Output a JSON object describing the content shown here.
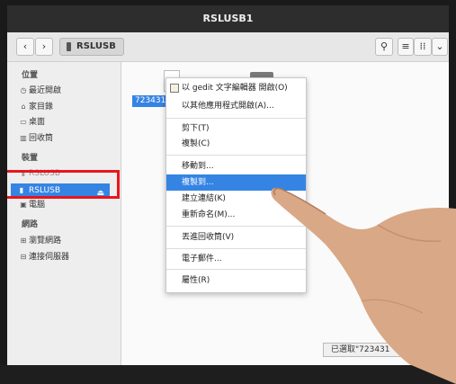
{
  "window": {
    "title": "RSLUSB1"
  },
  "toolbar": {
    "back_icon": "chevron-left-icon",
    "forward_icon": "chevron-right-icon",
    "path_label": "RSLUSB",
    "search_icon": "search-icon",
    "list_icon": "list-view-icon",
    "grid_icon": "grid-view-icon",
    "menu_icon": "chevron-down-icon"
  },
  "sidebar": {
    "places_heading": "位置",
    "places": [
      {
        "label": "最近開啟",
        "icon": "clock-icon"
      },
      {
        "label": "家目錄",
        "icon": "home-icon"
      },
      {
        "label": "桌面",
        "icon": "desktop-icon"
      },
      {
        "label": "回收筒",
        "icon": "trash-icon"
      }
    ],
    "devices_heading": "裝置",
    "devices": [
      {
        "label": "RSLUSB",
        "icon": "usb-drive-icon"
      },
      {
        "label": "RSLUSB",
        "icon": "usb-drive-icon",
        "selected": true
      },
      {
        "label": "電腦",
        "icon": "computer-icon"
      }
    ],
    "network_heading": "網路",
    "network": [
      {
        "label": "瀏覽網路",
        "icon": "network-icon"
      },
      {
        "label": "連接伺服器",
        "icon": "server-icon"
      }
    ]
  },
  "content": {
    "selected_file_label": "7234310",
    "status_text": "已選取\"723431"
  },
  "context_menu": {
    "items": [
      {
        "label": "以 gedit 文字編輯器 開啟(O)"
      },
      {
        "label": "以其他應用程式開啟(A)..."
      },
      {
        "label": "剪下(T)"
      },
      {
        "label": "複製(C)"
      },
      {
        "label": "移動到..."
      },
      {
        "label": "複製到...",
        "highlighted": true
      },
      {
        "label": "建立連結(K)"
      },
      {
        "label": "重新命名(M)..."
      },
      {
        "label": "丟進回收筒(V)"
      },
      {
        "label": "電子郵件..."
      },
      {
        "label": "屬性(R)"
      }
    ]
  },
  "colors": {
    "accent": "#3584e4",
    "annotation": "#e8151c"
  }
}
